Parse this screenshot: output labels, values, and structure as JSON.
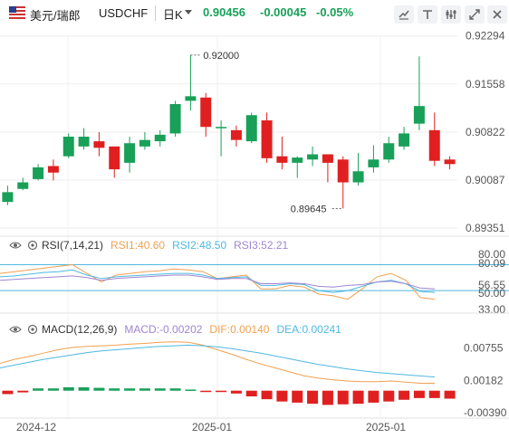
{
  "header": {
    "pair_name": "美元/瑞郎",
    "pair_code": "USDCHF",
    "period": "日K",
    "last_price": "0.90456",
    "change": "-0.00045",
    "change_pct": "-0.05%"
  },
  "toolbar_icons": [
    "line-tool-icon",
    "text-tool-icon",
    "settings-icon",
    "expand-icon",
    "close-icon"
  ],
  "colors": {
    "up": "#18a058",
    "down": "#e02020",
    "rsi1": "#f0a050",
    "rsi2": "#4fb8e0",
    "rsi3": "#a085d0",
    "macd_dif": "#f0a050",
    "macd_dea": "#4fb8e0"
  },
  "price_axis": [
    "0.92294",
    "0.91558",
    "0.90822",
    "0.90087",
    "0.89351"
  ],
  "high_label": "0.92000",
  "low_label": "0.89645",
  "rsi": {
    "label": "RSI(7,14,21)",
    "rsi1": "RSI1:40.60",
    "rsi2": "RSI2:48.50",
    "rsi3": "RSI3:52.21",
    "axis": [
      "80.00",
      "80.09",
      "56.55",
      "50.00",
      "33.00"
    ]
  },
  "macd": {
    "label": "MACD(12,26,9)",
    "macd": "MACD:-0.00202",
    "dif": "DIF:0.00140",
    "dea": "DEA:0.00241",
    "axis": [
      "0.00755",
      "0.00182",
      "-0.00390"
    ]
  },
  "x_labels": [
    "2024-12",
    "2025-01",
    "2025-01"
  ],
  "chart_data": {
    "type": "candlestick",
    "ylim": [
      0.8935,
      0.9229
    ],
    "candles": [
      {
        "o": 0.8975,
        "h": 0.9,
        "l": 0.897,
        "c": 0.899
      },
      {
        "o": 0.8995,
        "h": 0.9012,
        "l": 0.8993,
        "c": 0.9005
      },
      {
        "o": 0.901,
        "h": 0.9033,
        "l": 0.9008,
        "c": 0.9028
      },
      {
        "o": 0.903,
        "h": 0.904,
        "l": 0.9008,
        "c": 0.902
      },
      {
        "o": 0.9045,
        "h": 0.908,
        "l": 0.9042,
        "c": 0.9075
      },
      {
        "o": 0.906,
        "h": 0.9088,
        "l": 0.9055,
        "c": 0.9075
      },
      {
        "o": 0.9068,
        "h": 0.9082,
        "l": 0.9045,
        "c": 0.9058
      },
      {
        "o": 0.906,
        "h": 0.906,
        "l": 0.9012,
        "c": 0.9025
      },
      {
        "o": 0.9035,
        "h": 0.9075,
        "l": 0.902,
        "c": 0.9065
      },
      {
        "o": 0.906,
        "h": 0.9082,
        "l": 0.9055,
        "c": 0.907
      },
      {
        "o": 0.9068,
        "h": 0.9085,
        "l": 0.906,
        "c": 0.9078
      },
      {
        "o": 0.908,
        "h": 0.913,
        "l": 0.9075,
        "c": 0.9125
      },
      {
        "o": 0.913,
        "h": 0.92,
        "l": 0.9115,
        "c": 0.9137
      },
      {
        "o": 0.9135,
        "h": 0.9142,
        "l": 0.9075,
        "c": 0.909
      },
      {
        "o": 0.909,
        "h": 0.91,
        "l": 0.9045,
        "c": 0.909
      },
      {
        "o": 0.9085,
        "h": 0.9092,
        "l": 0.906,
        "c": 0.907
      },
      {
        "o": 0.9068,
        "h": 0.9112,
        "l": 0.9065,
        "c": 0.9108
      },
      {
        "o": 0.91,
        "h": 0.9112,
        "l": 0.9035,
        "c": 0.9042
      },
      {
        "o": 0.9045,
        "h": 0.9075,
        "l": 0.9025,
        "c": 0.9035
      },
      {
        "o": 0.9035,
        "h": 0.9045,
        "l": 0.9012,
        "c": 0.9043
      },
      {
        "o": 0.904,
        "h": 0.906,
        "l": 0.903,
        "c": 0.9048
      },
      {
        "o": 0.9048,
        "h": 0.9048,
        "l": 0.9005,
        "c": 0.9035
      },
      {
        "o": 0.904,
        "h": 0.9045,
        "l": 0.8965,
        "c": 0.9005
      },
      {
        "o": 0.9005,
        "h": 0.905,
        "l": 0.9,
        "c": 0.9022
      },
      {
        "o": 0.9028,
        "h": 0.9062,
        "l": 0.902,
        "c": 0.904
      },
      {
        "o": 0.904,
        "h": 0.9075,
        "l": 0.9035,
        "c": 0.9065
      },
      {
        "o": 0.906,
        "h": 0.909,
        "l": 0.9055,
        "c": 0.908
      },
      {
        "o": 0.9095,
        "h": 0.9198,
        "l": 0.9085,
        "c": 0.9122
      },
      {
        "o": 0.9085,
        "h": 0.9112,
        "l": 0.903,
        "c": 0.9038
      },
      {
        "o": 0.904,
        "h": 0.9045,
        "l": 0.9025,
        "c": 0.9033
      }
    ],
    "rsi_series": [
      {
        "name": "RSI1",
        "values": [
          70,
          72,
          74,
          76,
          78,
          80,
          70,
          60,
          68,
          70,
          72,
          73,
          75,
          74,
          72,
          64,
          66,
          68,
          52,
          52,
          56,
          54,
          46,
          44,
          40,
          52,
          66,
          70,
          62,
          42,
          40
        ]
      },
      {
        "name": "RSI2",
        "values": [
          66,
          67,
          69,
          71,
          72,
          74,
          68,
          64,
          66,
          67,
          68,
          69,
          70,
          70,
          68,
          64,
          65,
          66,
          56,
          56,
          58,
          57,
          50,
          48,
          50,
          55,
          60,
          62,
          58,
          49,
          48
        ]
      },
      {
        "name": "RSI3",
        "values": [
          62,
          63,
          64,
          65,
          66,
          67,
          65,
          62,
          64,
          65,
          66,
          67,
          68,
          68,
          66,
          63,
          64,
          64,
          58,
          58,
          59,
          58,
          55,
          54,
          56,
          57,
          60,
          61,
          58,
          53,
          52
        ]
      }
    ],
    "macd_series": [
      {
        "name": "DIF",
        "values": [
          0.0048,
          0.0055,
          0.006,
          0.0066,
          0.0072,
          0.0076,
          0.0078,
          0.0079,
          0.008,
          0.0082,
          0.0083,
          0.0085,
          0.0086,
          0.0085,
          0.008,
          0.0072,
          0.0064,
          0.0055,
          0.0047,
          0.004,
          0.0033,
          0.0026,
          0.0022,
          0.0019,
          0.0017,
          0.0016,
          0.0016,
          0.0017,
          0.0015,
          0.0013,
          0.0013
        ]
      },
      {
        "name": "DEA",
        "values": [
          0.004,
          0.0045,
          0.005,
          0.0055,
          0.0059,
          0.0063,
          0.0067,
          0.007,
          0.0072,
          0.0074,
          0.0076,
          0.0078,
          0.0079,
          0.008,
          0.0079,
          0.0077,
          0.0074,
          0.007,
          0.0066,
          0.0061,
          0.0056,
          0.0051,
          0.0046,
          0.0042,
          0.0038,
          0.0035,
          0.0032,
          0.003,
          0.0028,
          0.0026,
          0.0024
        ]
      }
    ],
    "macd_hist": [
      -0.0006,
      -0.0003,
      0.0004,
      0.0004,
      0.0006,
      0.0006,
      0.0005,
      0.0004,
      0.0004,
      0.0004,
      0.0004,
      0.0004,
      0.0002,
      -0.0001,
      -0.0002,
      -0.0005,
      -0.001,
      -0.0015,
      -0.0019,
      -0.0021,
      -0.0023,
      -0.0025,
      -0.0024,
      -0.0023,
      -0.0021,
      -0.0019,
      -0.0016,
      -0.0013,
      -0.0013,
      -0.0014
    ]
  }
}
